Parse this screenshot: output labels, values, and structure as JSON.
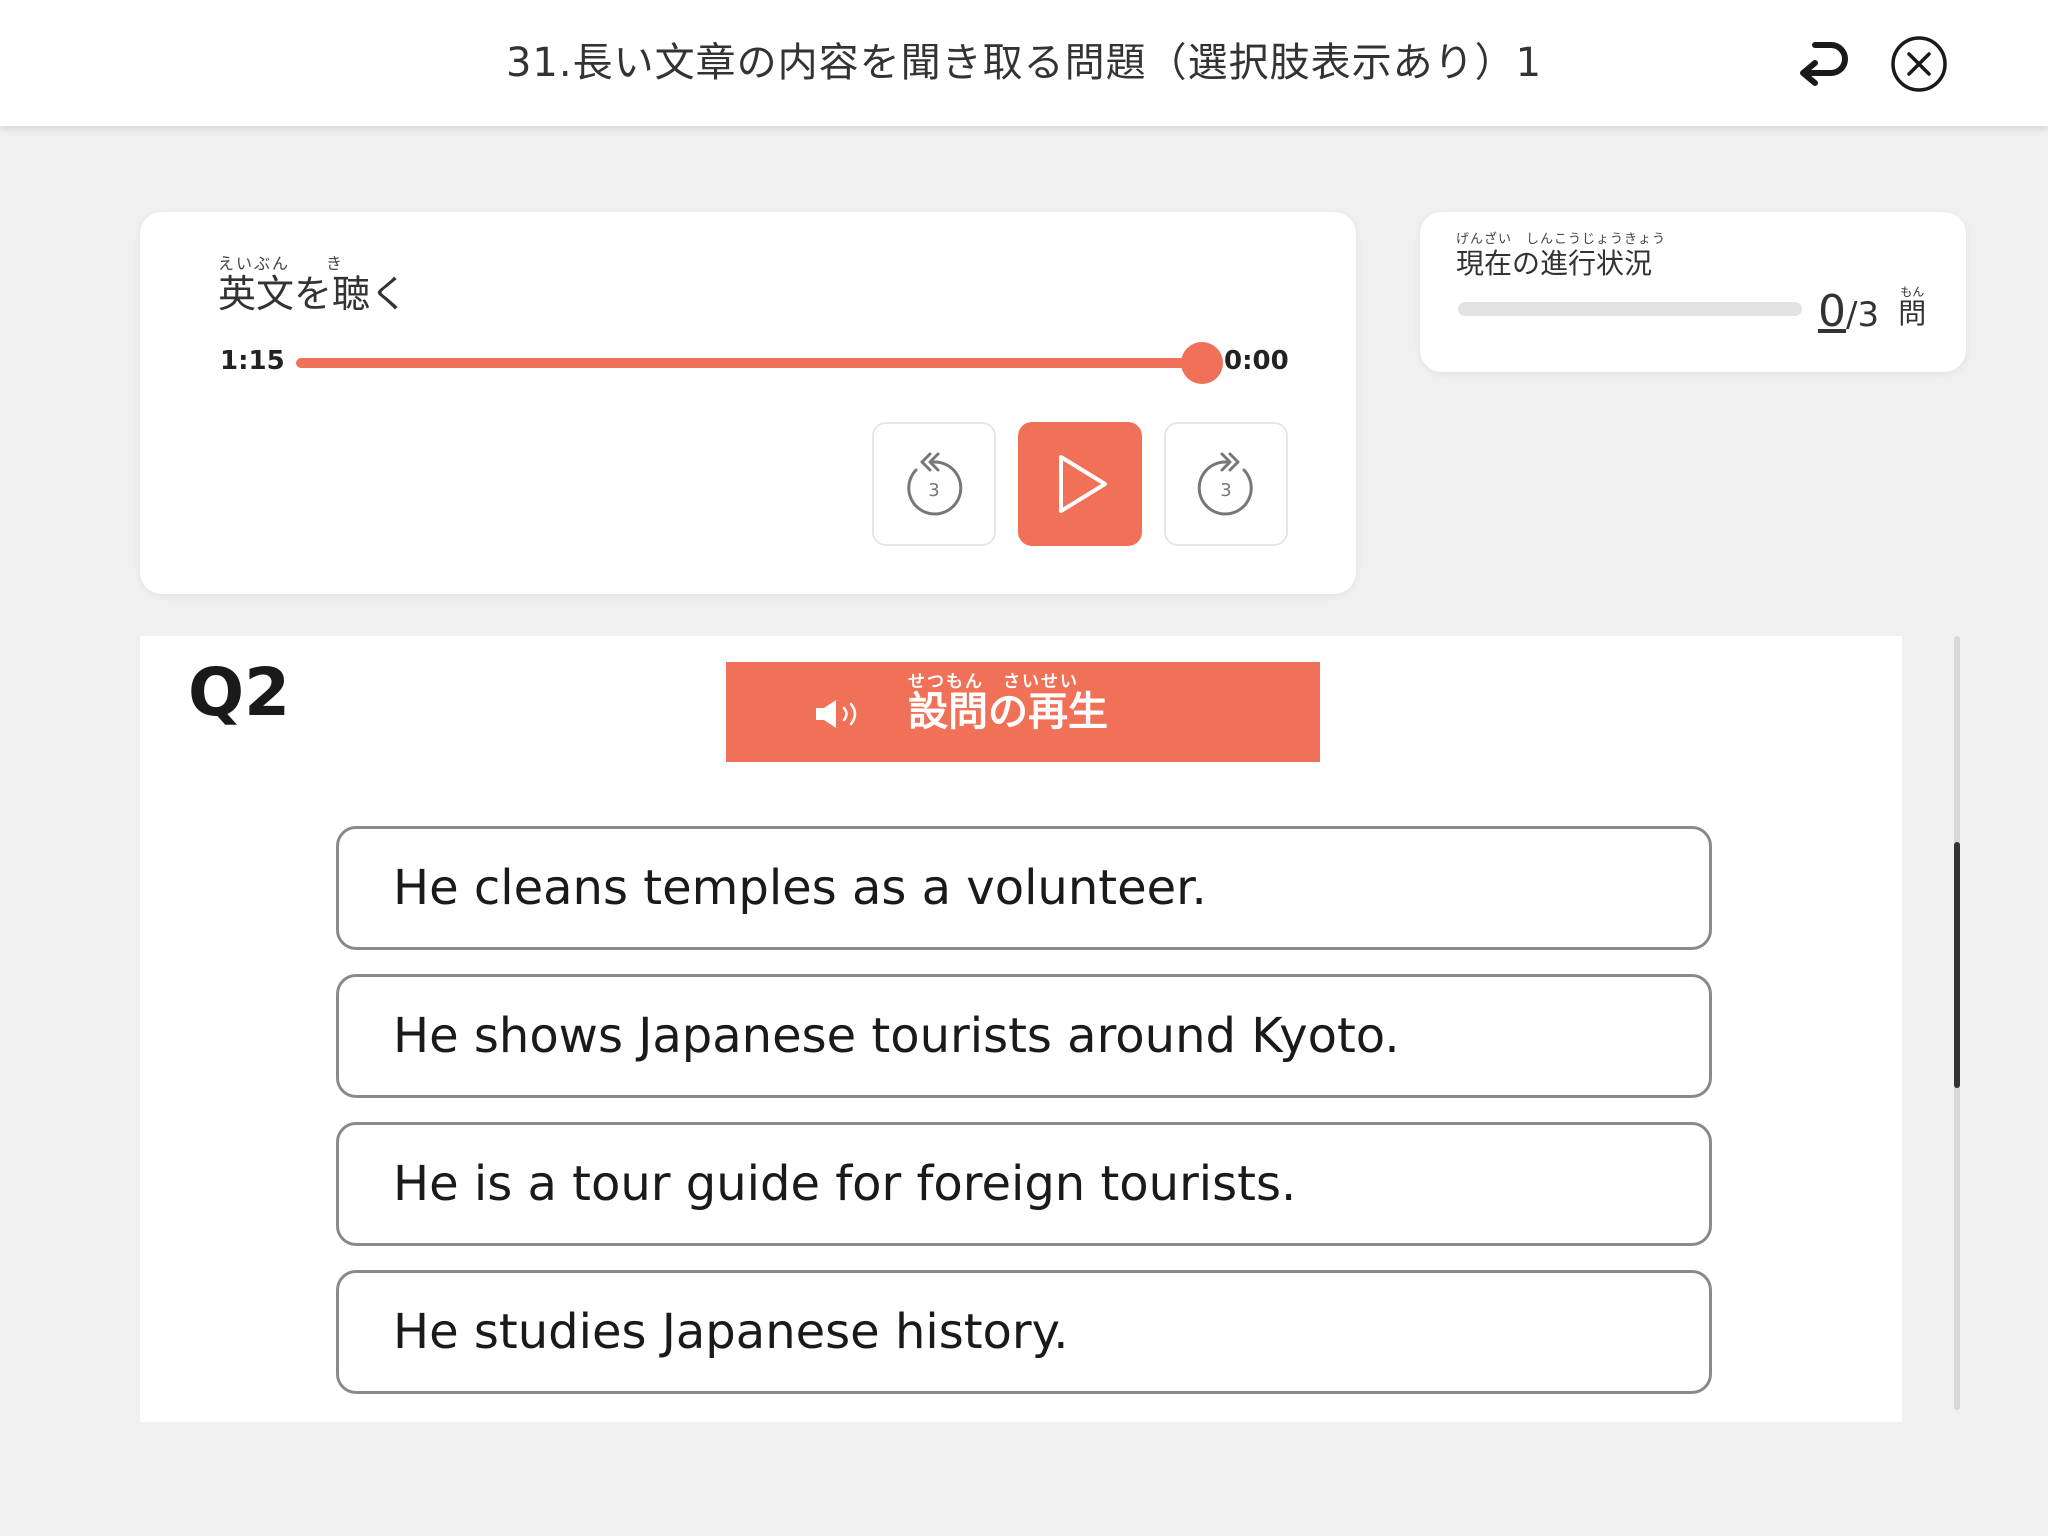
{
  "header": {
    "title": "31.長い文章の内容を聞き取る問題（選択肢表示あり）1",
    "back_icon": "undo-arrow-icon",
    "close_icon": "close-circle-icon"
  },
  "player": {
    "heading": "英文を聴く",
    "heading_ruby": "えいぶん　　き",
    "time_left": "1:15",
    "time_right": "0:00",
    "position_fraction": 1.0,
    "rewind_seconds": "3",
    "forward_seconds": "3"
  },
  "progress": {
    "heading": "現在の進行状況",
    "heading_ruby": "げんざい　しんこうじょうきょう",
    "current": "0",
    "total": "/3",
    "unit": "問",
    "unit_ruby": "もん",
    "fraction": 0
  },
  "question": {
    "label": "Q2",
    "play_button_label": "設問の再生",
    "play_button_ruby": "せつもん　さいせい",
    "choices": [
      "He cleans temples as a volunteer.",
      "He shows Japanese tourists around Kyoto.",
      "He is a tour guide for foreign tourists.",
      "He studies Japanese history."
    ]
  },
  "colors": {
    "accent": "#f07058",
    "border": "#8a8a8a",
    "background": "#f0f0f0"
  }
}
